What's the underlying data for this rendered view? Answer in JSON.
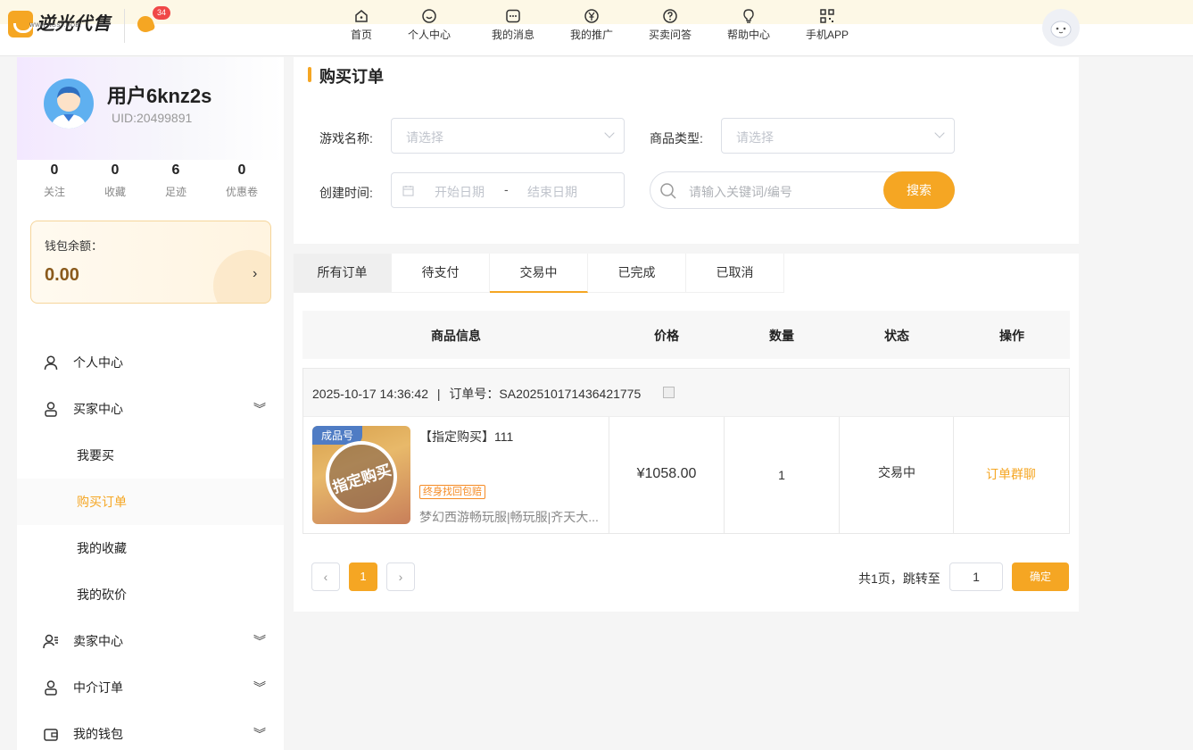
{
  "header": {
    "logo_text": "逆光代售",
    "logo_sub": "WWW.NGSY.MOBI",
    "notification_count": "34",
    "nav": [
      {
        "label": "首页",
        "icon": "home-icon"
      },
      {
        "label": "个人中心",
        "icon": "smile-icon"
      },
      {
        "label": "我的消息",
        "icon": "message-icon"
      },
      {
        "label": "我的推广",
        "icon": "yen-icon"
      },
      {
        "label": "买卖问答",
        "icon": "question-icon"
      },
      {
        "label": "帮助中心",
        "icon": "bulb-icon"
      },
      {
        "label": "手机APP",
        "icon": "qrcode-icon"
      }
    ]
  },
  "sidebar": {
    "username": "用户6knz2s",
    "uid": "UID:20499891",
    "stats": [
      {
        "value": "0",
        "label": "关注"
      },
      {
        "value": "0",
        "label": "收藏"
      },
      {
        "value": "6",
        "label": "足迹"
      },
      {
        "value": "0",
        "label": "优惠卷"
      }
    ],
    "wallet": {
      "label": "钱包余额：",
      "value": "0.00",
      "arrow": "›"
    },
    "menu": [
      {
        "label": "个人中心",
        "icon": "user-icon",
        "type": "top"
      },
      {
        "label": "买家中心",
        "icon": "user-icon",
        "type": "top",
        "expandable": true
      },
      {
        "label": "我要买",
        "type": "sub"
      },
      {
        "label": "购买订单",
        "type": "sub",
        "active": true
      },
      {
        "label": "我的收藏",
        "type": "sub"
      },
      {
        "label": "我的砍价",
        "type": "sub"
      },
      {
        "label": "卖家中心",
        "icon": "users-list-icon",
        "type": "top",
        "expandable": true
      },
      {
        "label": "中介订单",
        "icon": "user-icon",
        "type": "top",
        "expandable": true
      },
      {
        "label": "我的钱包",
        "icon": "wallet-icon",
        "type": "top",
        "expandable": true
      }
    ]
  },
  "filters": {
    "title": "购买订单",
    "game_label": "游戏名称:",
    "game_placeholder": "请选择",
    "type_label": "商品类型:",
    "type_placeholder": "请选择",
    "date_label": "创建时间:",
    "date_start": "开始日期",
    "date_sep": "-",
    "date_end": "结束日期",
    "search_placeholder": "请输入关键词/编号",
    "search_button": "搜索"
  },
  "orders": {
    "tabs": [
      "所有订单",
      "待支付",
      "交易中",
      "已完成",
      "已取消"
    ],
    "active_tab": "交易中",
    "columns": [
      "商品信息",
      "价格",
      "数量",
      "状态",
      "操作"
    ],
    "list": [
      {
        "datetime": "2025-10-17 14:36:42",
        "separator": "|",
        "order_no": "订单号：SA202510171436421775",
        "thumb_tag": "成品号",
        "thumb_stamp": "指定购买",
        "product_name": "【指定购买】111",
        "product_tag": "终身找回包赔",
        "product_desc": "梦幻西游畅玩服|畅玩服|齐天大...",
        "price": "¥1058.00",
        "quantity": "1",
        "status": "交易中",
        "action": "订单群聊"
      }
    ]
  },
  "pagination": {
    "prev": "‹",
    "current": "1",
    "next": "›",
    "summary": "共1页，跳转至",
    "jump_value": "1",
    "confirm": "确定"
  },
  "colors": {
    "accent": "#f5a623",
    "badge": "#f04848"
  }
}
